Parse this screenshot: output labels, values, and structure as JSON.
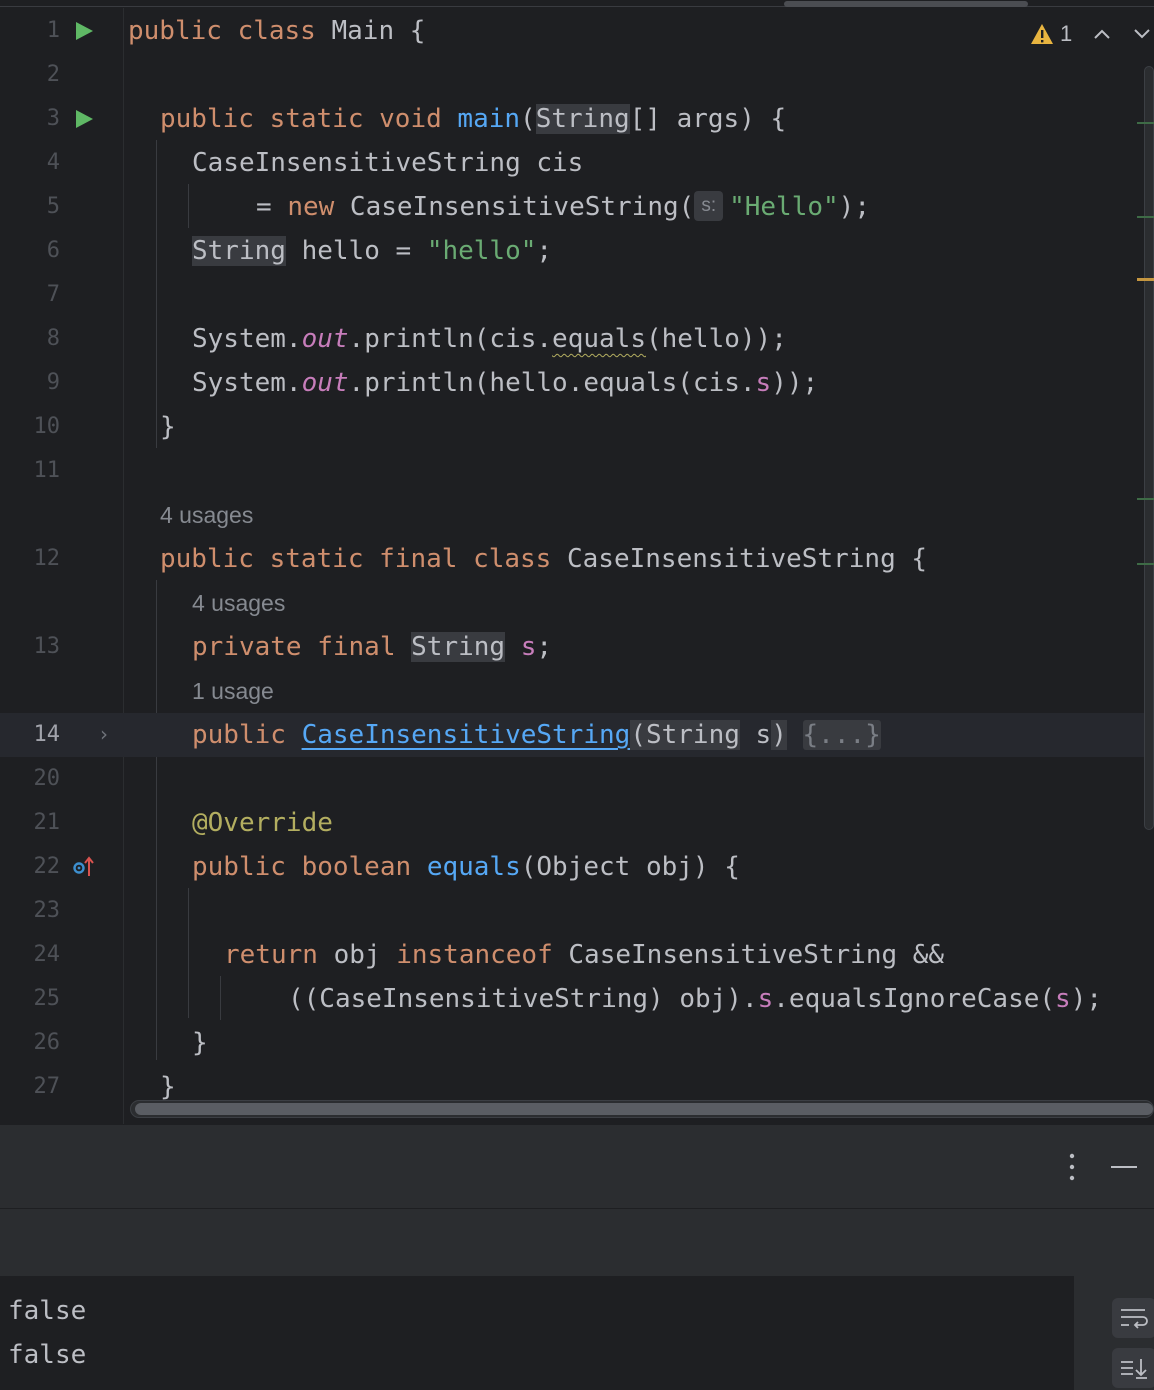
{
  "editor": {
    "warnings": {
      "count": "1"
    },
    "lines": [
      {
        "num": "1",
        "run": true
      },
      {
        "num": "2"
      },
      {
        "num": "3",
        "run": true
      },
      {
        "num": "4"
      },
      {
        "num": "5"
      },
      {
        "num": "6"
      },
      {
        "num": "7"
      },
      {
        "num": "8"
      },
      {
        "num": "9"
      },
      {
        "num": "10"
      },
      {
        "num": "11"
      },
      {
        "num": "12"
      },
      {
        "num": "13"
      },
      {
        "num": "14"
      },
      {
        "num": "20"
      },
      {
        "num": "21"
      },
      {
        "num": "22"
      },
      {
        "num": "23"
      },
      {
        "num": "24"
      },
      {
        "num": "25"
      },
      {
        "num": "26"
      },
      {
        "num": "27"
      }
    ],
    "code": {
      "l1": {
        "kw": "public class",
        "name": " Main {"
      },
      "l3": {
        "kw": "public static void",
        "fn": "main",
        "p1": "(",
        "type": "String",
        "p2": "[] args) {"
      },
      "l4": {
        "text": "CaseInsensitiveString cis"
      },
      "l5": {
        "eq": "= ",
        "kw": "new",
        "rest": " CaseInsensitiveString(",
        "hint": "s:",
        "str": "\"Hello\"",
        "end": ");"
      },
      "l6": {
        "type": "String",
        "mid": " hello = ",
        "str": "\"hello\"",
        "end": ";"
      },
      "l8": {
        "a": "System.",
        "out": "out",
        "b": ".println(cis.",
        "eq": "equals",
        "c": "(hello));"
      },
      "l9": {
        "a": "System.",
        "out": "out",
        "b": ".println(hello.equals(cis.",
        "s": "s",
        "c": "));"
      },
      "l10": {
        "text": "}"
      },
      "hint12": "4 usages",
      "l12": {
        "kw": "public static final class",
        "rest": " CaseInsensitiveString {"
      },
      "hint13": "4 usages",
      "l13": {
        "kw": "private final",
        "type": "String",
        "s": "s",
        "end": ";"
      },
      "hint14": "1 usage",
      "l14": {
        "kw": "public",
        "fn": "CaseInsensitiveString",
        "p": "(",
        "type": "String",
        "s": " s",
        "cp": ")",
        "fold": "{...}"
      },
      "l21": {
        "ann": "@Override"
      },
      "l22": {
        "kw": "public boolean",
        "fn": "equals",
        "rest": "(Object obj) {"
      },
      "l24": {
        "kw1": "return",
        "mid": " obj ",
        "kw2": "instanceof",
        "rest": " CaseInsensitiveString &&"
      },
      "l25": {
        "a": "((CaseInsensitiveString) obj).",
        "s1": "s",
        "b": ".equalsIgnoreCase(",
        "s2": "s",
        "c": ");"
      },
      "l26": {
        "text": "}"
      },
      "l27": {
        "text": "}"
      }
    }
  },
  "console": {
    "output": [
      "false",
      "false"
    ]
  },
  "icons": {
    "run": "run-triangle-icon",
    "warning": "warning-triangle-icon",
    "fold": "chevron-right-icon",
    "override": "override-up-arrow-icon",
    "more": "more-vertical-icon",
    "minimize": "minimize-icon",
    "soft_wrap": "soft-wrap-icon",
    "scroll_end": "scroll-to-end-icon"
  },
  "colors": {
    "background": "#1e1f22",
    "keyword": "#cf8e6d",
    "function": "#56a8f5",
    "string": "#6aab73",
    "field": "#c77dbb",
    "annotation": "#b3ae60",
    "run": "#5fb865",
    "warning": "#e8b440"
  }
}
